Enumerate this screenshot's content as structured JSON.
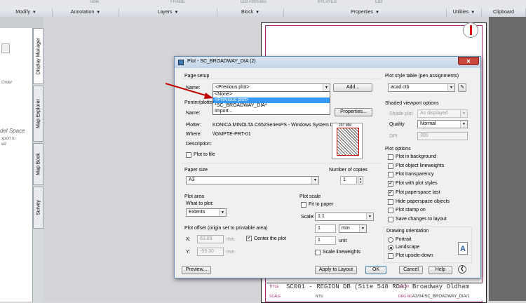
{
  "ribbon": {
    "strip_items": [
      "Table",
      "FRAME",
      "Edit Attributes",
      "BYLAYER",
      "Edit"
    ],
    "panels": [
      {
        "title": "Modify"
      },
      {
        "title": "Annotation"
      },
      {
        "title": "Layers"
      },
      {
        "title": "Block"
      },
      {
        "title": "Properties"
      },
      {
        "title": "Utilities"
      },
      {
        "title": "Clipboard"
      }
    ]
  },
  "left_palette": {
    "tabs": [
      "Display Manager",
      "Map Explorer",
      "Map Book",
      "Survey"
    ],
    "text_fragments": [
      "Order",
      "del Space",
      "xport to",
      "ed"
    ]
  },
  "drawing": {
    "title_block": {
      "title_label": "TITLE",
      "title_value": "SC001 - REGION DB (Site 548 RDA)",
      "location_label": "LOC'N",
      "location_value": "Broadway Oldham",
      "scale_label": "SCALE",
      "scale_value": "NTS",
      "drawing_no_label": "DRG NO",
      "drawing_no_value": "A3/04/SC_BROADWAY_DIA/1"
    }
  },
  "dialog": {
    "title": "Plot - SC_BROADWAY_DIA (2)",
    "close_icon": "close-icon",
    "page_setup": {
      "group_label": "Page setup",
      "name_label": "Name:",
      "name_value": "<Previous plot>",
      "add_button": "Add...",
      "name_options": [
        "<None>",
        "<Previous plot>",
        "*SC_BROADWAY_DIA*",
        "Import..."
      ],
      "selected_index": 1
    },
    "printer": {
      "group_label": "Printer/plotter",
      "name_label": "Name:",
      "properties_button": "Properties...",
      "plotter_label": "Plotter:",
      "plotter_value": "KONICA MINOLTA C652SeriesPS - Windows System Driv...",
      "where_label": "Where:",
      "where_value": "\\\\GMPTE-PRT-01",
      "description_label": "Description:",
      "plot_to_file_label": "Plot to file",
      "plot_to_file": false,
      "preview_dim_top": "297 MM"
    },
    "paper_size": {
      "group_label": "Paper size",
      "value": "A3"
    },
    "copies": {
      "label": "Number of copies",
      "value": "1"
    },
    "plot_area": {
      "group_label": "Plot area",
      "what_label": "What to plot:",
      "value": "Extents"
    },
    "plot_offset": {
      "group_label": "Plot offset (origin set to printable area)",
      "x_label": "X:",
      "x_value": "63.89",
      "x_unit": "mm",
      "y_label": "Y:",
      "y_value": "-59.30",
      "y_unit": "mm",
      "center_label": "Center the plot",
      "center": true
    },
    "plot_scale": {
      "group_label": "Plot scale",
      "fit_label": "Fit to paper",
      "fit": false,
      "scale_label": "Scale:",
      "scale_value": "1:1",
      "num_value": "1",
      "num_unit": "mm",
      "den_value": "1",
      "den_unit": "unit",
      "lineweights_label": "Scale lineweights",
      "lineweights": false
    },
    "style_table": {
      "group_label": "Plot style table (pen assignments)",
      "value": "acad.ctb"
    },
    "shaded_viewport": {
      "group_label": "Shaded viewport options",
      "shade_label": "Shade plot",
      "shade_value": "As displayed",
      "quality_label": "Quality",
      "quality_value": "Normal",
      "dpi_label": "DPI",
      "dpi_value": "300"
    },
    "plot_options": {
      "group_label": "Plot options",
      "items": [
        {
          "label": "Plot in background",
          "checked": false
        },
        {
          "label": "Plot object lineweights",
          "checked": false
        },
        {
          "label": "Plot transparency",
          "checked": false
        },
        {
          "label": "Plot with plot styles",
          "checked": true
        },
        {
          "label": "Plot paperspace last",
          "checked": true
        },
        {
          "label": "Hide paperspace objects",
          "checked": false
        },
        {
          "label": "Plot stamp on",
          "checked": false
        },
        {
          "label": "Save changes to layout",
          "checked": false
        }
      ]
    },
    "orientation": {
      "group_label": "Drawing orientation",
      "portrait": "Portrait",
      "landscape": "Landscape",
      "selected": "Landscape",
      "upside_down": "Plot upside-down",
      "upside_down_checked": false,
      "preview_glyph": "A"
    },
    "footer": {
      "preview": "Preview...",
      "apply": "Apply to Layout",
      "ok": "OK",
      "cancel": "Cancel",
      "help": "Help",
      "collapse_icon": "chevron-left-icon"
    }
  },
  "annotation": {
    "arrow_color": "#c00000"
  }
}
